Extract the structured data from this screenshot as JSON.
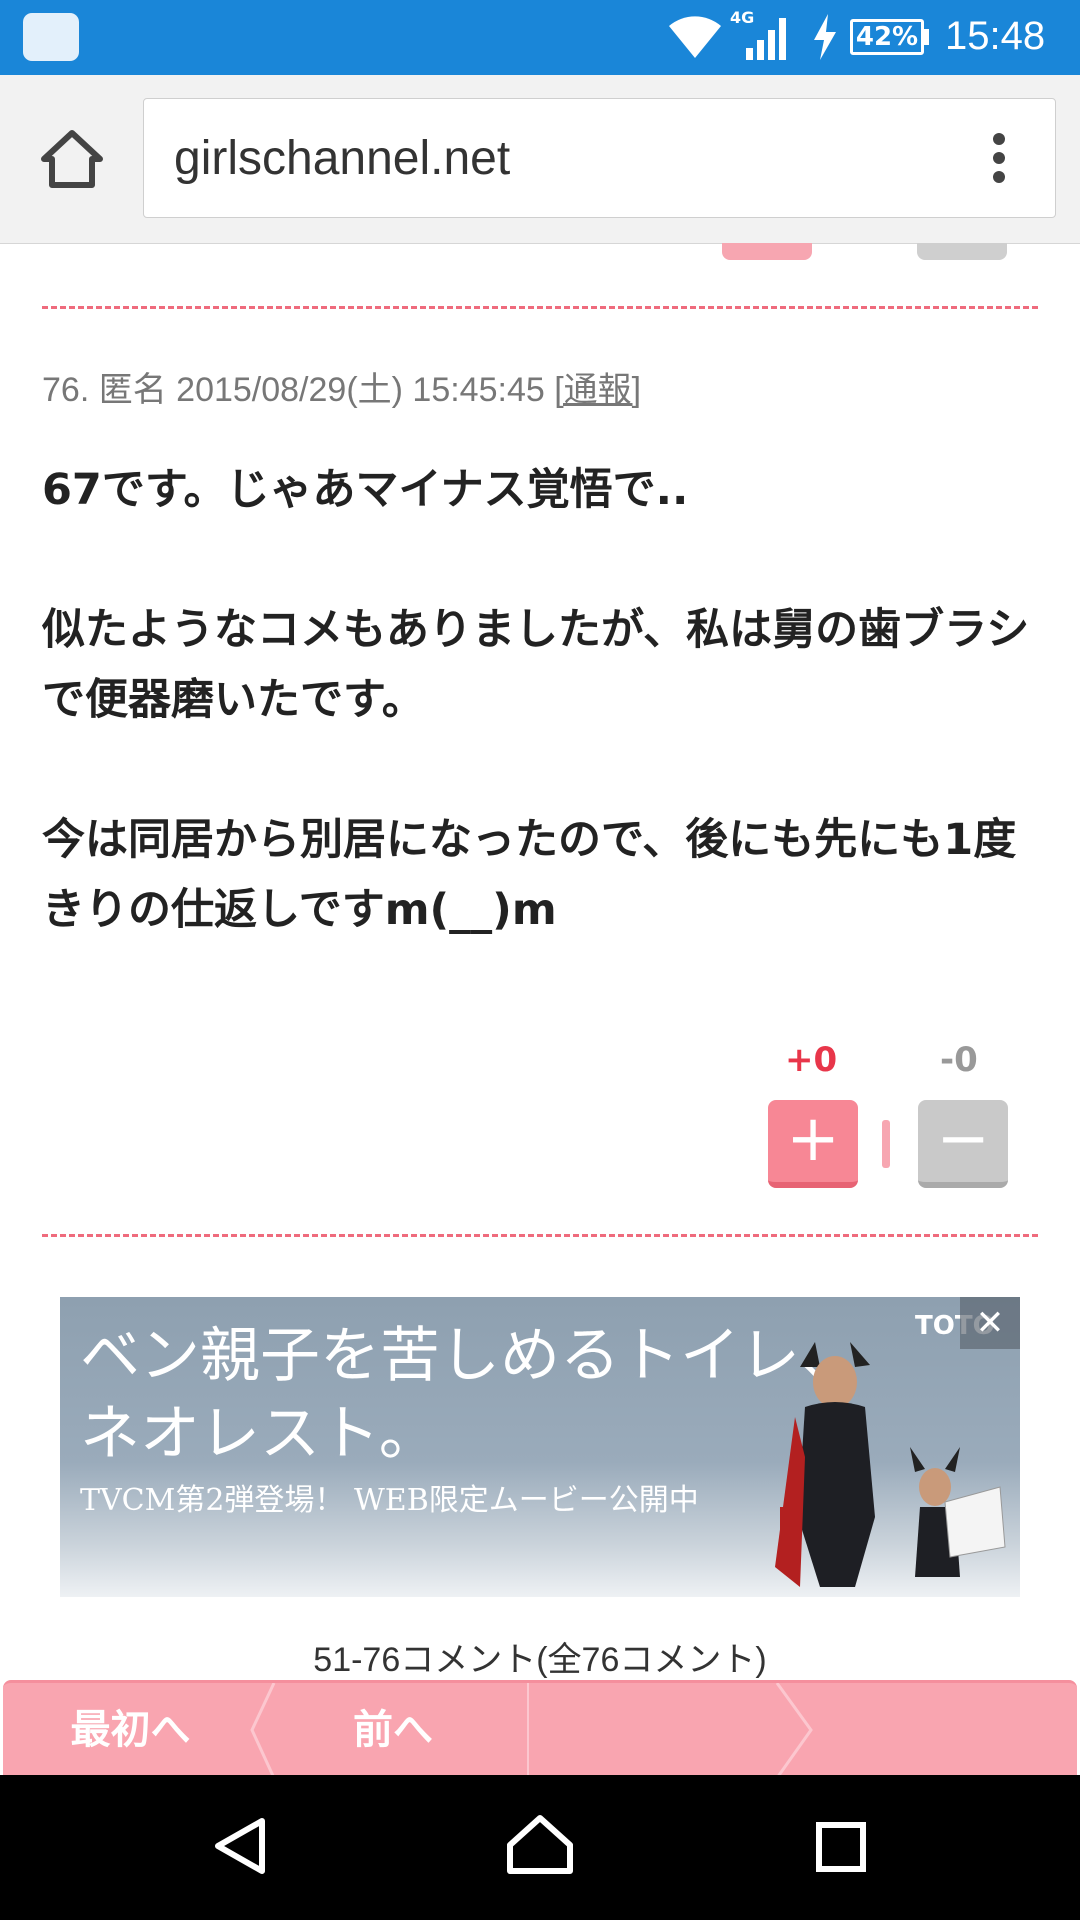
{
  "status_bar": {
    "network": "4G",
    "battery": "42%",
    "time": "15:48"
  },
  "browser": {
    "url": "girlschannel.net"
  },
  "comment": {
    "meta_prefix": "76. 匿名 2015/08/29(土) 15:45:45 ",
    "report_label": "[通報]",
    "body": "67です。じゃあマイナス覚悟で..\n\n似たようなコメもありましたが、私は舅の歯ブラシで便器磨いたです。\n\n今は同居から別居になったので、後にも先にも1度きりの仕返しですm(__)m",
    "plus_count": "+0",
    "minus_count": "-0",
    "plus_symbol": "+",
    "minus_symbol": "−"
  },
  "ad": {
    "headline": "ベン親子を苦しめるトイレ、\nネオレスト。",
    "subtext": "TVCM第2弾登場！ WEB限定ムービー公開中",
    "brand": "TOTO",
    "close_symbol": "✕"
  },
  "pagination": {
    "info": "51-76コメント(全76コメント)",
    "first_label": "最初へ",
    "prev_label": "前へ",
    "next_label": ""
  },
  "colors": {
    "status_bar": "#1a86d8",
    "accent_pink": "#f78795",
    "plus_red": "#e8364a",
    "divider": "#ef6b7d"
  },
  "icons": [
    "home-icon",
    "more-vert-icon",
    "wifi-icon",
    "signal-icon",
    "charging-icon",
    "back-icon",
    "nav-home-icon",
    "recents-icon"
  ]
}
